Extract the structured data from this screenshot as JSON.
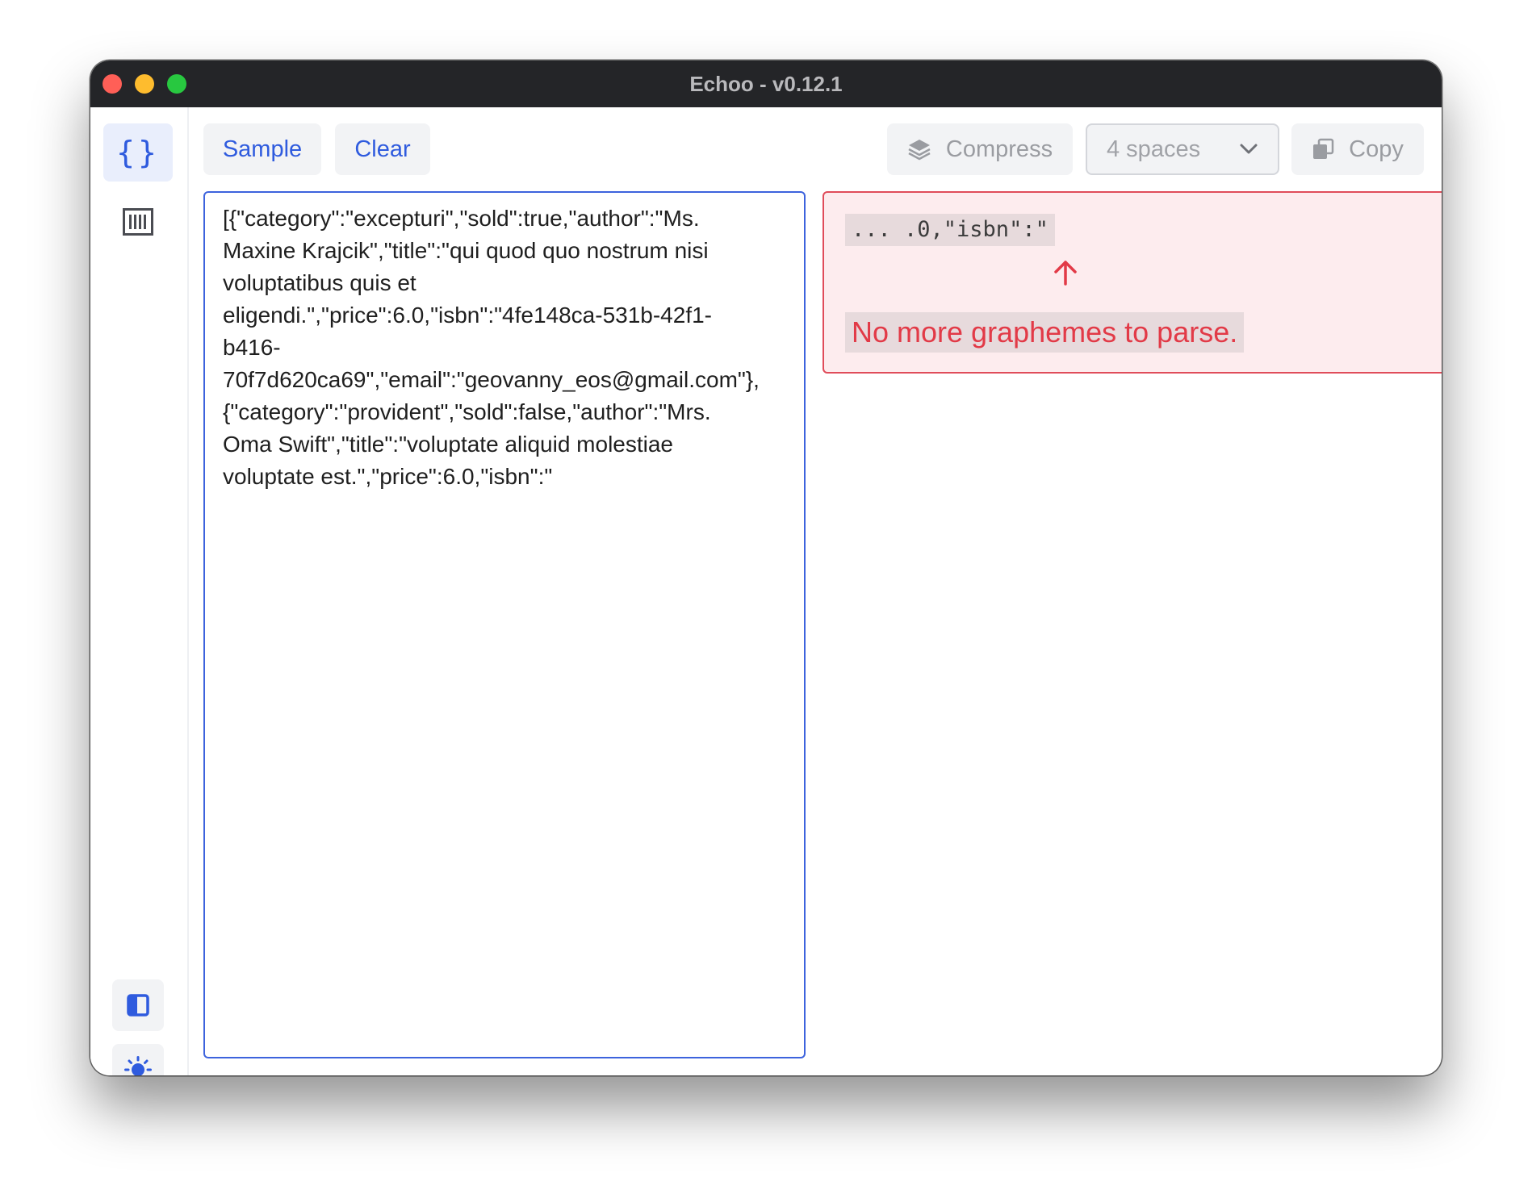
{
  "window": {
    "title": "Echoo - v0.12.1"
  },
  "sidebar": {
    "json_tool_glyph": "{}",
    "icons": [
      "braces-icon",
      "barcode-icon",
      "sidebar-toggle-icon",
      "sun-icon"
    ]
  },
  "toolbar": {
    "sample_label": "Sample",
    "clear_label": "Clear",
    "compress_label": "Compress",
    "indent_selected": "4 spaces",
    "copy_label": "Copy"
  },
  "editor": {
    "content": "[{\"category\":\"excepturi\",\"sold\":true,\"author\":\"Ms.\nMaxine Krajcik\",\"title\":\"qui quod quo nostrum nisi\nvoluptatibus quis et\neligendi.\",\"price\":6.0,\"isbn\":\"4fe148ca-531b-42f1-\nb416-\n70f7d620ca69\",\"email\":\"geovanny_eos@gmail.com\"},\n{\"category\":\"provident\",\"sold\":false,\"author\":\"Mrs.\nOma Swift\",\"title\":\"voluptate aliquid molestiae\nvoluptate est.\",\"price\":6.0,\"isbn\":\""
  },
  "error": {
    "snippet": "... .0,\"isbn\":\"",
    "message": "No more graphemes to parse."
  },
  "colors": {
    "accent": "#2f5bde",
    "error": "#e23a47",
    "error_bg": "#fdecee",
    "titlebar": "#242528"
  }
}
